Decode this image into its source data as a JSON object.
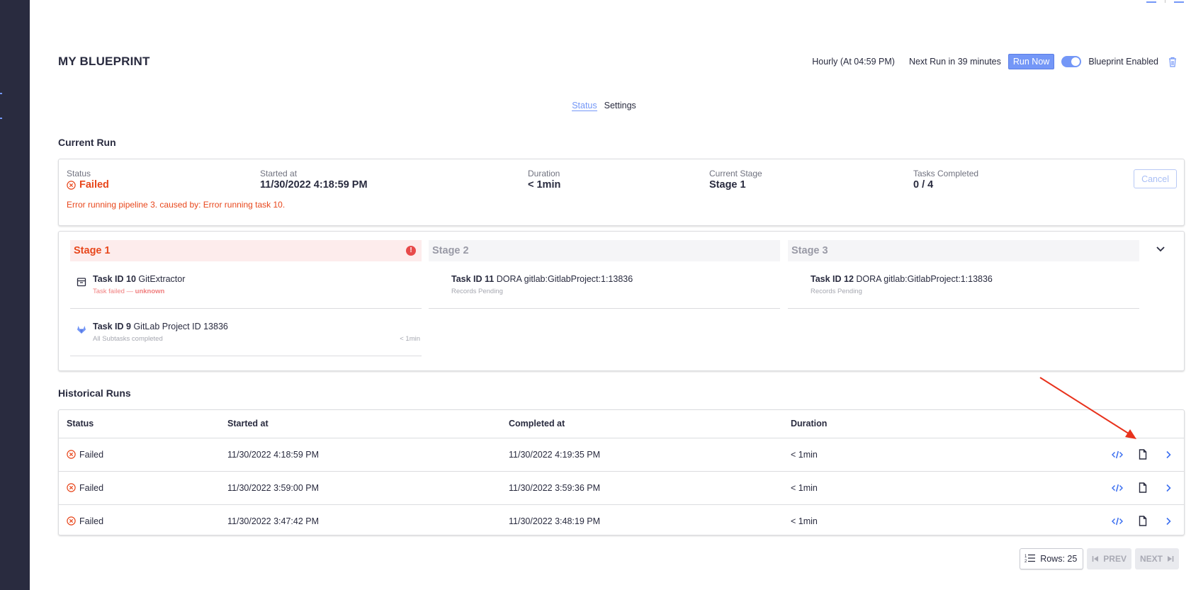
{
  "page": {
    "title": "MY BLUEPRINT",
    "schedule": "Hourly (At 04:59 PM)",
    "next_run": "Next Run in 39 minutes",
    "run_now_label": "Run Now",
    "enabled_label": "Blueprint Enabled",
    "enabled": true
  },
  "tabs": [
    {
      "label": "Status",
      "active": true
    },
    {
      "label": "Settings",
      "active": false
    }
  ],
  "current_run": {
    "section_title": "Current Run",
    "status_label": "Status",
    "status_value": "Failed",
    "started_label": "Started at",
    "started_value": "11/30/2022 4:18:59 PM",
    "duration_label": "Duration",
    "duration_value": "< 1min",
    "stage_label": "Current Stage",
    "stage_value": "Stage 1",
    "tasks_label": "Tasks Completed",
    "tasks_value": "0 / 4",
    "error_message": "Error running pipeline 3. caused by: Error running task 10.",
    "cancel_label": "Cancel"
  },
  "stages": [
    {
      "name": "Stage 1",
      "status": "failed",
      "tasks": [
        {
          "id_label": "Task ID 10",
          "name": "GitExtractor",
          "sub_prefix": "Task failed — ",
          "sub_strong": "unknown",
          "duration": "",
          "icon": "package-icon"
        },
        {
          "id_label": "Task ID 9",
          "name": "GitLab Project ID 13836",
          "sub_prefix": "All Subtasks completed",
          "sub_strong": "",
          "duration": "< 1min",
          "icon": "gitlab-icon"
        }
      ]
    },
    {
      "name": "Stage 2",
      "status": "pending",
      "tasks": [
        {
          "id_label": "Task ID 11",
          "name": "DORA gitlab:GitlabProject:1:13836",
          "sub_prefix": "Records Pending",
          "sub_strong": "",
          "duration": "",
          "icon": ""
        }
      ]
    },
    {
      "name": "Stage 3",
      "status": "pending",
      "tasks": [
        {
          "id_label": "Task ID 12",
          "name": "DORA gitlab:GitlabProject:1:13836",
          "sub_prefix": "Records Pending",
          "sub_strong": "",
          "duration": "",
          "icon": ""
        }
      ]
    }
  ],
  "historical": {
    "section_title": "Historical Runs",
    "columns": [
      "Status",
      "Started at",
      "Completed at",
      "Duration"
    ],
    "rows": [
      {
        "status": "Failed",
        "started": "11/30/2022 4:18:59 PM",
        "completed": "11/30/2022 4:19:35 PM",
        "duration": "< 1min"
      },
      {
        "status": "Failed",
        "started": "11/30/2022 3:59:00 PM",
        "completed": "11/30/2022 3:59:36 PM",
        "duration": "< 1min"
      },
      {
        "status": "Failed",
        "started": "11/30/2022 3:47:42 PM",
        "completed": "11/30/2022 3:48:19 PM",
        "duration": "< 1min"
      }
    ]
  },
  "pagination": {
    "rows_label": "Rows: 25",
    "prev_label": "PREV",
    "next_label": "NEXT"
  },
  "colors": {
    "accent": "#7497f7",
    "error": "#e8471c",
    "sidebar": "#292b3f",
    "annotation_arrow": "#e8321c"
  }
}
